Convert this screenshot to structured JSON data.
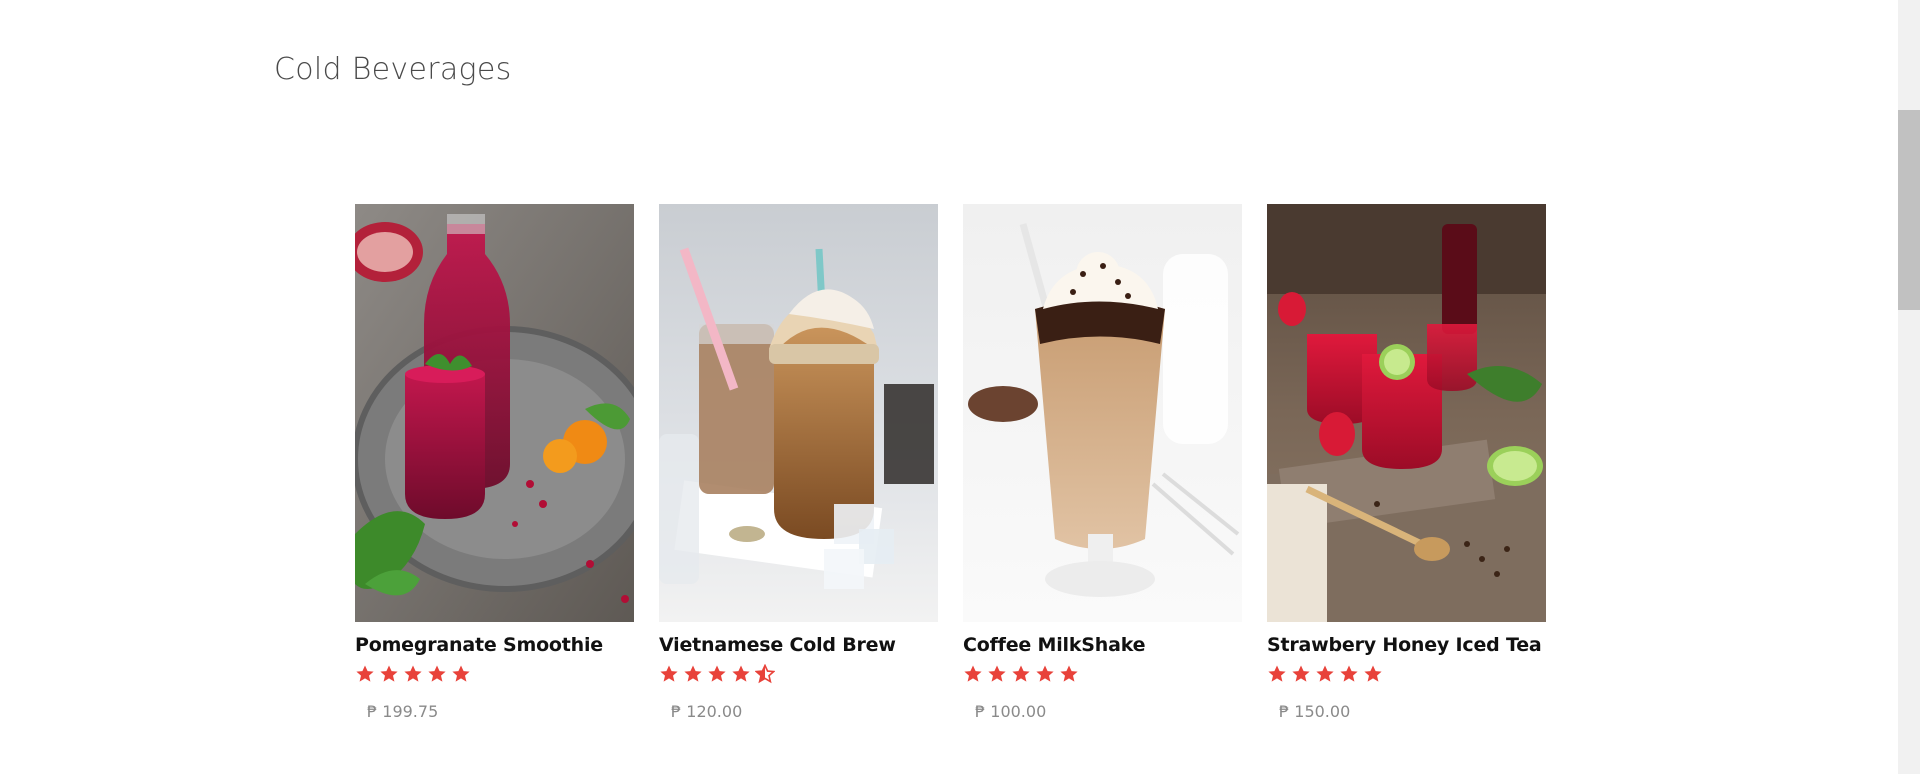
{
  "section": {
    "title": "Cold Beverages"
  },
  "products": [
    {
      "name": "Pomegranate Smoothie",
      "rating": 5,
      "rating_max": 5,
      "price": "₱ 199.75"
    },
    {
      "name": "Vietnamese Cold Brew",
      "rating": 4.5,
      "rating_max": 5,
      "price": "₱ 120.00"
    },
    {
      "name": "Coffee MilkShake",
      "rating": 5,
      "rating_max": 5,
      "price": "₱ 100.00"
    },
    {
      "name": "Strawbery Honey Iced Tea",
      "rating": 5,
      "rating_max": 5,
      "price": "₱ 150.00"
    }
  ],
  "colors": {
    "star": "#e8423a",
    "title_text": "#4a4a4a",
    "product_name": "#111111",
    "price_text": "#8a8a8a"
  },
  "icons": {
    "star_full": "star-icon",
    "star_half": "star-half-icon"
  }
}
